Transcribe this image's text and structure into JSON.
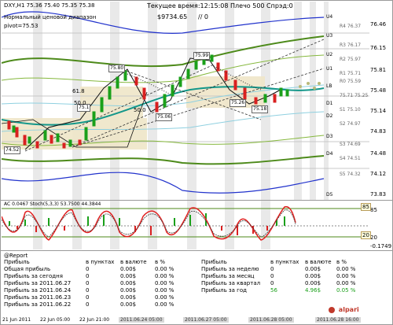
{
  "chart": {
    "symbol_header": "DXY,H1  75.36 75.40 75.35 75.38",
    "title_server_time": "Текущее время:12:15:08 Плечо 500 Спрэд:0",
    "balance": "$9734.65",
    "balance_suffix": "// 0",
    "range_label": "Нормальный ценовой диапазон",
    "pivot_label": "pivot=75.53",
    "level_labels": {
      "u4": "U4",
      "u3": "U3",
      "u2": "U2",
      "u1": "U1",
      "lb": "LB",
      "d1": "D1",
      "d2": "D2",
      "d3": "D3",
      "d4": "D4",
      "d5": "D5"
    },
    "right_axis": [
      "76.46",
      "76.15",
      "75.81",
      "75.48",
      "75.14",
      "74.83",
      "74.48",
      "74.12",
      "73.83"
    ],
    "bg_grid_labels": [
      "R4 76.37",
      "R3 76.17",
      "R2 75.97",
      "R1 75.71",
      "R0 75.59",
      "75.71 75.25",
      "S1 75.10",
      "S2 74.97",
      "S3 74.69",
      "S4 74.51",
      "S5 74.32"
    ],
    "price_tags": {
      "t7580": "75.80",
      "t7599": "75.99",
      "t7526": "75.26",
      "t7518": "75.18",
      "t7506": "75.06",
      "t7513": "75.1",
      "t7452": "74.52"
    },
    "fib": {
      "f618": "61.8",
      "f500": "50.0",
      "f50b": "50.0"
    }
  },
  "indicator": {
    "header": "AC 0.0467  Stoch(5,3,3) 53.7500 44.3844",
    "axis": [
      "85",
      "20",
      "-0.1749"
    ],
    "level_top": "85",
    "level_bottom": "20"
  },
  "report": {
    "title": "@Report",
    "left_headers": [
      "Прибыль",
      "в пунктах",
      "в валюте",
      "в %"
    ],
    "left_rows": [
      {
        "label": "Общая прибыль",
        "points": "0",
        "money": "0.00$",
        "percent": "0.00 %"
      },
      {
        "label": "Прибыль за сегодня",
        "points": "0",
        "money": "0.00$",
        "percent": "0.00 %"
      },
      {
        "label": "Прибыль за 2011.06.27",
        "points": "0",
        "money": "0.00$",
        "percent": "0.00 %"
      },
      {
        "label": "Прибыль за 2011.06.24",
        "points": "0",
        "money": "0.00$",
        "percent": "0.00 %"
      },
      {
        "label": "Прибыль за 2011.06.23",
        "points": "0",
        "money": "0.00$",
        "percent": "0.00 %"
      },
      {
        "label": "Прибыль за 2011.06.22",
        "points": "0",
        "money": "0.00$",
        "percent": "0.00 %"
      }
    ],
    "right_headers": [
      "Прибыль",
      "в пунктах",
      "в валюте",
      "в %"
    ],
    "right_rows": [
      {
        "label": "Прибыль за неделю",
        "points": "0",
        "money": "0.00$",
        "percent": "0.00 %"
      },
      {
        "label": "Прибыль за месяц",
        "points": "0",
        "money": "0.00$",
        "percent": "0.00 %"
      },
      {
        "label": "Прибыль за квартал",
        "points": "0",
        "money": "0.00$",
        "percent": "0.00 %"
      },
      {
        "label": "Прибыль за год",
        "points": "56",
        "money": "4.96$",
        "percent": "0.05 %"
      }
    ]
  },
  "time_axis": [
    "21 Jun 2011",
    "22 Jun 05:00",
    "22 Jun 21:00",
    "2011.06.24 05:00",
    "2011.06.27 05:00",
    "2011.06.28 05:00",
    "2011.06.28 16:00"
  ],
  "brand": "alpari",
  "colors": {
    "bull": "#1aa01a",
    "bear": "#d92020",
    "blue_band": "#2233cc",
    "green_band": "#4d8a1a",
    "teal_ma": "#14978a"
  }
}
